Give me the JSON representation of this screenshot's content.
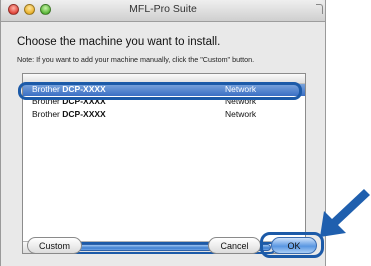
{
  "window": {
    "title": "MFL-Pro Suite"
  },
  "dialog": {
    "heading": "Choose the machine you want to install.",
    "note": "Note: If you want to add your machine manually, click the \"Custom\" button."
  },
  "list": {
    "columns": [
      "",
      ""
    ],
    "rows": [
      {
        "prefix": "Brother ",
        "model": "DCP-XXXX",
        "type": "Network",
        "selected": true
      },
      {
        "prefix": "Brother ",
        "model": "DCP-XXXX",
        "type": "Network",
        "selected": false
      },
      {
        "prefix": "Brother ",
        "model": "DCP-XXXX",
        "type": "Network",
        "selected": false
      }
    ],
    "scroll_left_icon": "◂",
    "scroll_right_icon": "▸"
  },
  "buttons": {
    "custom": "Custom",
    "cancel": "Cancel",
    "ok": "OK"
  },
  "colors": {
    "highlight": "#1c5aa8",
    "arrow": "#1f5fae",
    "selection": "#3b6fc4"
  },
  "icons": {
    "arrow": "pointer-arrow-icon"
  }
}
